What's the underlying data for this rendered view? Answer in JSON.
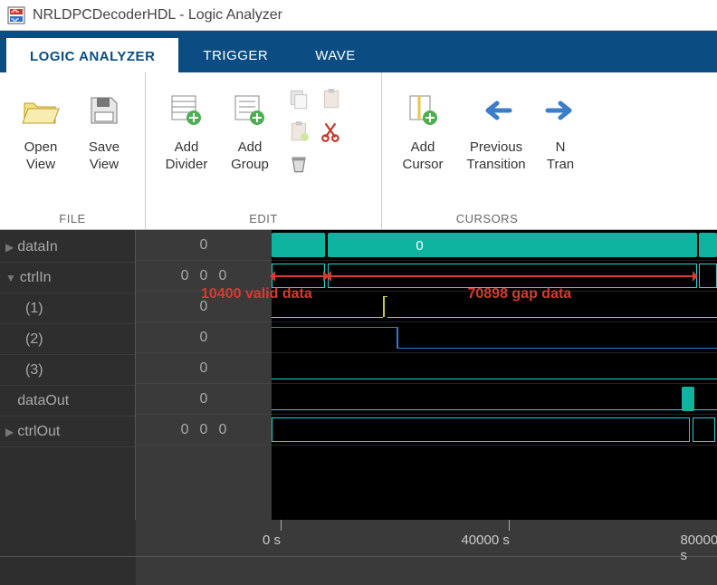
{
  "window": {
    "title": "NRLDPCDecoderHDL - Logic Analyzer"
  },
  "tabs": {
    "logic": "LOGIC ANALYZER",
    "trigger": "TRIGGER",
    "wave": "WAVE"
  },
  "groups": {
    "file": "FILE",
    "edit": "EDIT",
    "cursors": "CURSORS"
  },
  "buttons": {
    "open_view": "Open\nView",
    "save_view": "Save\nView",
    "add_divider": "Add\nDivider",
    "add_group": "Add\nGroup",
    "add_cursor": "Add\nCursor",
    "prev_transition": "Previous\nTransition",
    "next_transition": "N\nTran"
  },
  "signals": {
    "dataIn": "dataIn",
    "ctrlIn": "ctrlIn",
    "sub1": "(1)",
    "sub2": "(2)",
    "sub3": "(3)",
    "dataOut": "dataOut",
    "ctrlOut": "ctrlOut"
  },
  "values": {
    "dataIn": "0",
    "ctrlIn1": "0",
    "ctrlIn2": "0",
    "ctrlIn3": "0",
    "sub1": "0",
    "sub2": "0",
    "sub3": "0",
    "dataOut": "0",
    "ctrlOut1": "0",
    "ctrlOut2": "0",
    "ctrlOut3": "0"
  },
  "waveform": {
    "zero_label": "0"
  },
  "annotations": {
    "valid": "10400 valid data",
    "gap": "70898 gap data"
  },
  "ruler": {
    "t0": "0 s",
    "t1": "40000 s",
    "t2": "80000 s"
  },
  "chart_data": {
    "type": "table",
    "description": "Digital waveform timing view",
    "time_axis_unit": "s",
    "time_ticks": [
      0,
      40000,
      80000
    ],
    "signals": [
      {
        "name": "dataIn",
        "value_at_cursor": 0
      },
      {
        "name": "ctrlIn",
        "value_at_cursor": [
          0,
          0,
          0
        ]
      },
      {
        "name": "ctrlIn(1)",
        "value_at_cursor": 0
      },
      {
        "name": "ctrlIn(2)",
        "value_at_cursor": 0
      },
      {
        "name": "ctrlIn(3)",
        "value_at_cursor": 0
      },
      {
        "name": "dataOut",
        "value_at_cursor": 0
      },
      {
        "name": "ctrlOut",
        "value_at_cursor": [
          0,
          0,
          0
        ]
      }
    ],
    "annotations": [
      {
        "label": "10400 valid data",
        "span_samples": 10400
      },
      {
        "label": "70898 gap data",
        "span_samples": 70898
      }
    ]
  }
}
